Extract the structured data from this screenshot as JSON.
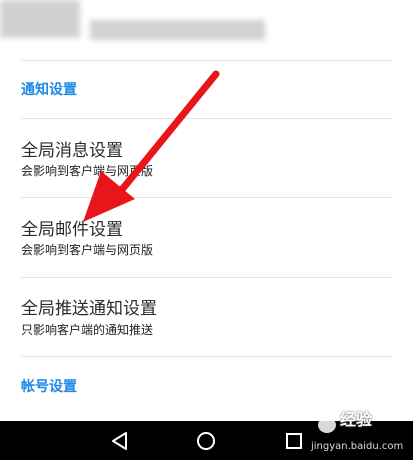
{
  "sections": {
    "notification": {
      "label": "通知设置"
    },
    "account": {
      "label": "帐号设置"
    }
  },
  "settings": [
    {
      "title": "全局消息设置",
      "desc": "会影响到客户端与网页版"
    },
    {
      "title": "全局邮件设置",
      "desc": "会影响到客户端与网页版"
    },
    {
      "title": "全局推送通知设置",
      "desc": "只影响客户端的通知推送"
    }
  ],
  "watermark": {
    "brand": "经验",
    "url": "jingyan.baidu.com"
  },
  "icons": {
    "back": "back-triangle-icon",
    "home": "home-circle-icon",
    "recents": "recents-square-icon",
    "annotation": "red-arrow-icon"
  },
  "colors": {
    "section_header": "#1e88e5",
    "annotation_arrow": "#e8161b",
    "nav_bar": "#000000"
  }
}
